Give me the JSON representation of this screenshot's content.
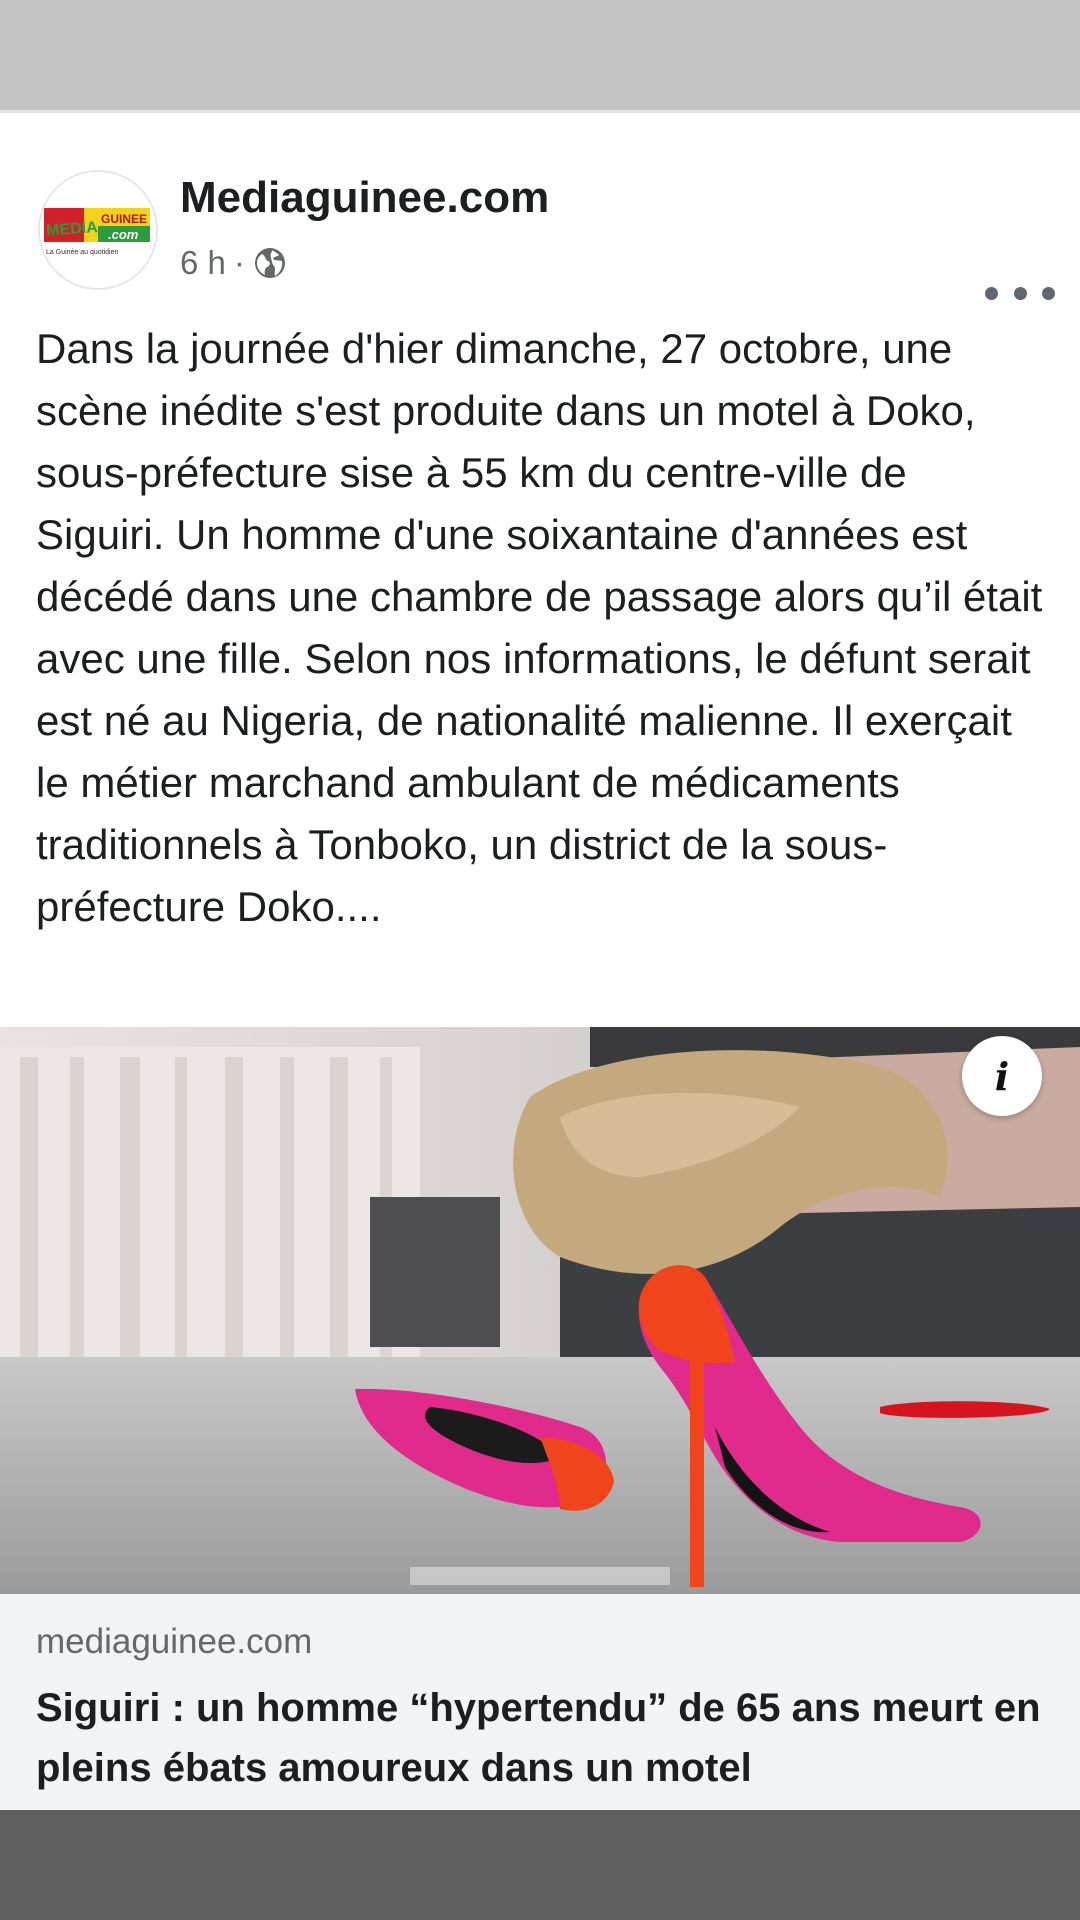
{
  "post": {
    "page_name": "Mediaguinee.com",
    "time": "6 h",
    "separator": "·",
    "visibility_icon": "globe-icon",
    "more_icon": "more-options-icon",
    "text": "Dans la journée d'hier dimanche, 27 octobre, une scène inédite s'est produite dans un motel à Doko, sous-préfecture sise à 55 km du centre-ville de Siguiri. Un homme d'une soixantaine d'années est décédé dans une chambre de passage alors qu’il était avec une fille. Selon nos informations, le défunt serait est né au Nigeria, de nationalité malienne. Il exerçait le métier marchand ambulant de médicaments traditionnels à Tonboko, un district de la sous-préfecture Doko...."
  },
  "avatar": {
    "logo_word_1": "MEDIA",
    "logo_word_2": "GUINEE",
    "logo_word_3": ".com",
    "tagline": "La Guinée au quotidien"
  },
  "link": {
    "domain": "mediaguinee.com",
    "title": "Siguiri : un homme “hypertendu” de 65 ans meurt en pleins ébats amoureux dans un motel",
    "info_icon": "info-icon",
    "info_label": "i"
  },
  "colors": {
    "page_bg": "#c4c4c4",
    "bottom_bar": "#5f5f5f",
    "text_primary": "#1c1e21",
    "text_secondary": "#65676b",
    "preview_bg": "#f2f3f5",
    "logo_red": "#d1202a",
    "logo_green": "#2e9b3c",
    "logo_yellow": "#f2d21b"
  }
}
